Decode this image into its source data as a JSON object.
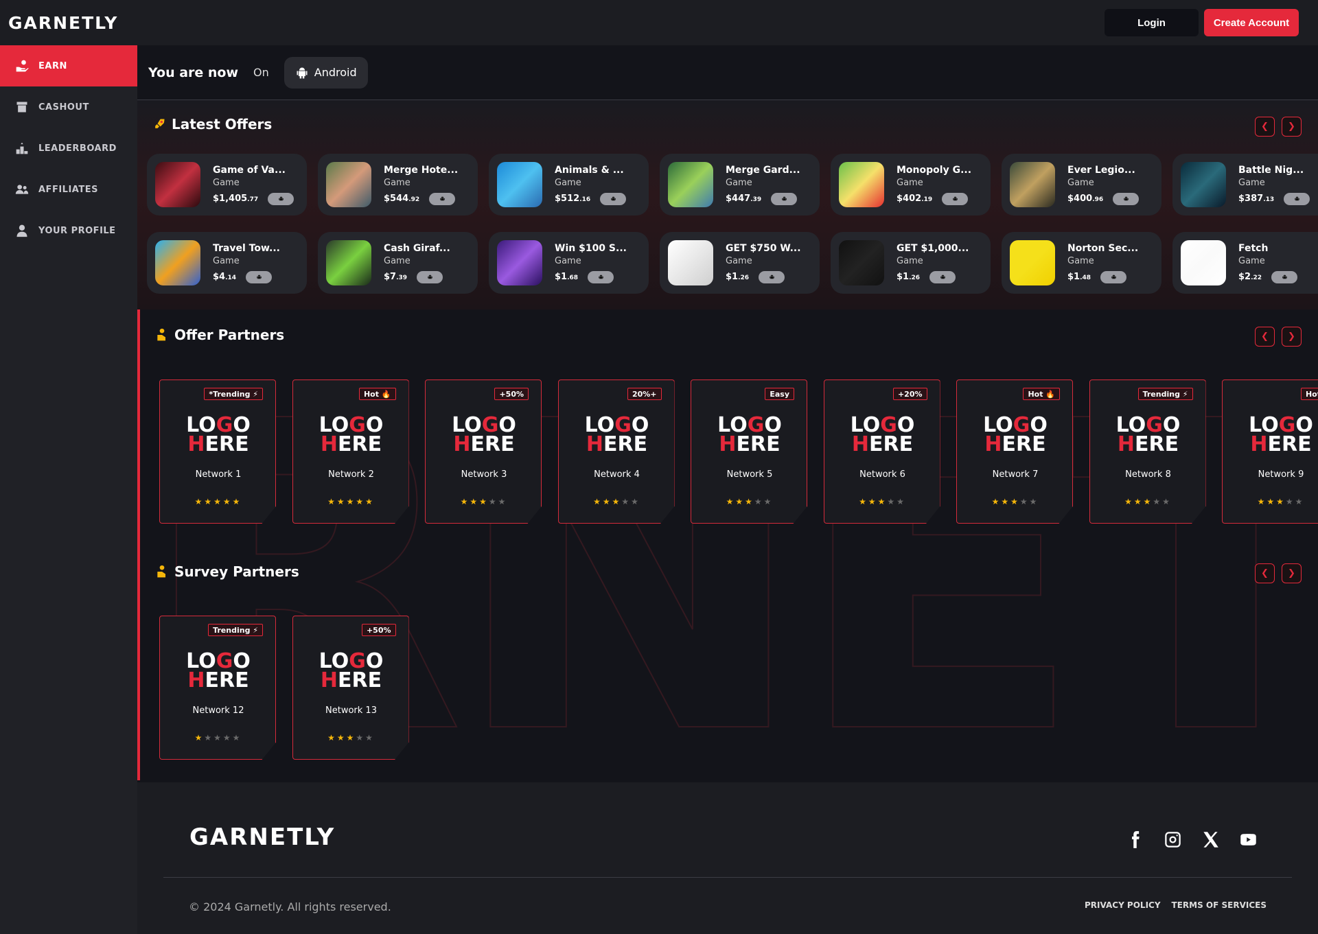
{
  "brand": "GARNETLY",
  "header": {
    "login": "Login",
    "create_account": "Create Account"
  },
  "sidebar": {
    "items": [
      {
        "label": "EARN",
        "icon": "hand-coin-icon"
      },
      {
        "label": "CASHOUT",
        "icon": "register-icon"
      },
      {
        "label": "LEADERBOARD",
        "icon": "podium-icon"
      },
      {
        "label": "AFFILIATES",
        "icon": "users-icon"
      },
      {
        "label": "YOUR PROFILE",
        "icon": "user-icon"
      }
    ]
  },
  "platform": {
    "you_are_now": "You are now",
    "on": "On",
    "platform": "Android"
  },
  "latest_offers": {
    "title": "Latest Offers",
    "items": [
      {
        "title": "Game of Va...",
        "type": "Game",
        "price": "$1,405",
        "cents": ".77"
      },
      {
        "title": "Merge Hote...",
        "type": "Game",
        "price": "$544",
        "cents": ".92"
      },
      {
        "title": "Animals & ...",
        "type": "Game",
        "price": "$512",
        "cents": ".16"
      },
      {
        "title": "Merge Gard...",
        "type": "Game",
        "price": "$447",
        "cents": ".39"
      },
      {
        "title": "Monopoly G...",
        "type": "Game",
        "price": "$402",
        "cents": ".19"
      },
      {
        "title": "Ever Legio...",
        "type": "Game",
        "price": "$400",
        "cents": ".96"
      },
      {
        "title": "Battle Nig...",
        "type": "Game",
        "price": "$387",
        "cents": ".13"
      },
      {
        "title": "Travel Tow...",
        "type": "Game",
        "price": "$4",
        "cents": ".14"
      },
      {
        "title": "Cash Giraf...",
        "type": "Game",
        "price": "$7",
        "cents": ".39"
      },
      {
        "title": "Win $100 S...",
        "type": "Game",
        "price": "$1",
        "cents": ".68"
      },
      {
        "title": "GET $750 W...",
        "type": "Game",
        "price": "$1",
        "cents": ".26"
      },
      {
        "title": "GET $1,000...",
        "type": "Game",
        "price": "$1",
        "cents": ".26"
      },
      {
        "title": "Norton Sec...",
        "type": "Game",
        "price": "$1",
        "cents": ".48"
      },
      {
        "title": "Fetch",
        "type": "Game",
        "price": "$2",
        "cents": ".22"
      }
    ]
  },
  "offer_partners": {
    "title": "Offer Partners",
    "items": [
      {
        "badge": "*Trending ⚡",
        "name": "Network 1",
        "stars": 5
      },
      {
        "badge": "Hot 🔥",
        "name": "Network 2",
        "stars": 5
      },
      {
        "badge": "+50%",
        "name": "Network 3",
        "stars": 3
      },
      {
        "badge": "20%+",
        "name": "Network 4",
        "stars": 3
      },
      {
        "badge": "Easy",
        "name": "Network 5",
        "stars": 3
      },
      {
        "badge": "+20%",
        "name": "Network 6",
        "stars": 3
      },
      {
        "badge": "Hot 🔥",
        "name": "Network 7",
        "stars": 3
      },
      {
        "badge": "Trending ⚡",
        "name": "Network 8",
        "stars": 3
      },
      {
        "badge": "Hot",
        "name": "Network 9",
        "stars": 3
      }
    ]
  },
  "survey_partners": {
    "title": "Survey Partners",
    "items": [
      {
        "badge": "Trending ⚡",
        "name": "Network 12",
        "stars": 1
      },
      {
        "badge": "+50%",
        "name": "Network 13",
        "stars": 3
      }
    ]
  },
  "logo_placeholder": {
    "line1a": "LO",
    "line1b": "G",
    "line1c": "O",
    "line2a": "H",
    "line2b": "ERE"
  },
  "footer": {
    "copyright": "© 2024 Garnetly. All rights reserved.",
    "privacy": "PRIVACY POLICY",
    "terms": "TERMS OF SERVICES"
  },
  "colors": {
    "accent": "#e5293b",
    "star": "#f5b60a"
  }
}
